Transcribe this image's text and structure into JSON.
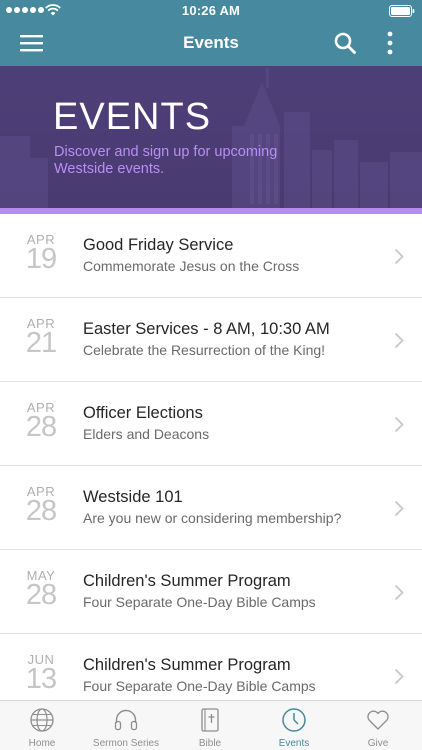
{
  "status_bar": {
    "time": "10:26 AM"
  },
  "nav": {
    "title": "Events"
  },
  "hero": {
    "title": "EVENTS",
    "subtitle": "Discover and sign up for upcoming Westside events."
  },
  "events": [
    {
      "month": "APR",
      "day": "19",
      "title": "Good Friday Service",
      "description": "Commemorate Jesus on the Cross"
    },
    {
      "month": "APR",
      "day": "21",
      "title": "Easter Services - 8 AM, 10:30 AM",
      "description": "Celebrate the Resurrection of the King!"
    },
    {
      "month": "APR",
      "day": "28",
      "title": "Officer Elections",
      "description": "Elders and Deacons"
    },
    {
      "month": "APR",
      "day": "28",
      "title": "Westside 101",
      "description": "Are you new or considering membership?"
    },
    {
      "month": "MAY",
      "day": "28",
      "title": "Children's Summer Program",
      "description": "Four Separate One-Day Bible Camps"
    },
    {
      "month": "JUN",
      "day": "13",
      "title": "Children's Summer Program",
      "description": "Four Separate One-Day Bible Camps"
    }
  ],
  "tabs": [
    {
      "label": "Home",
      "icon": "globe-icon",
      "active": false
    },
    {
      "label": "Sermon Series",
      "icon": "headphones-icon",
      "active": false
    },
    {
      "label": "Bible",
      "icon": "bible-icon",
      "active": false
    },
    {
      "label": "Events",
      "icon": "clock-icon",
      "active": true
    },
    {
      "label": "Give",
      "icon": "heart-icon",
      "active": false
    }
  ],
  "colors": {
    "nav_bar": "#47899e",
    "hero_background": "#4a3a72",
    "hero_accent": "#b48cf3",
    "active_tab": "#47899e"
  }
}
